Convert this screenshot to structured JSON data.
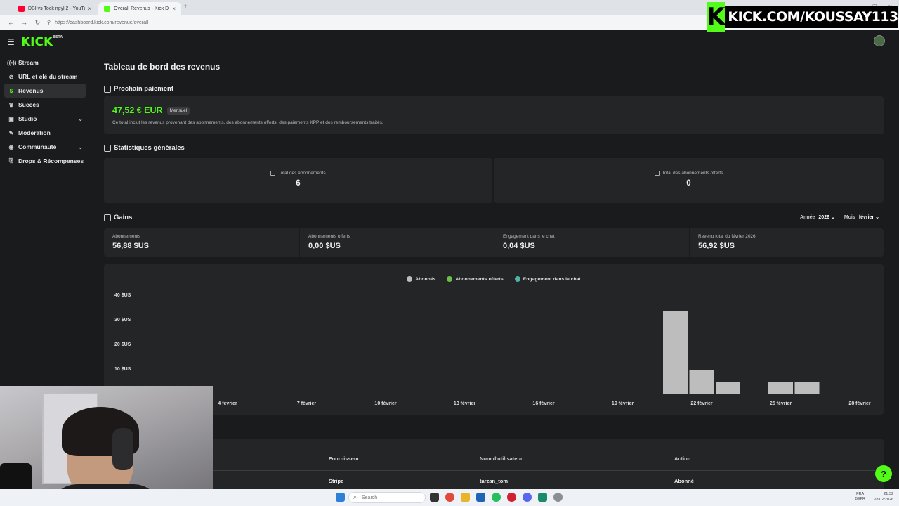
{
  "browser": {
    "tabs": [
      {
        "title": "DBI vs Tock ngyl 2 - YouTube",
        "close": "×",
        "active": false,
        "favicon_color": "#ff0033"
      },
      {
        "title": "Overall Revenus - Kick Dashbo",
        "close": "×",
        "active": true,
        "favicon_color": "#53fc18"
      }
    ],
    "new_tab": "+",
    "url": "https://dashboard.kick.com/revenue/overall",
    "window_controls": [
      "–",
      "□",
      "×"
    ]
  },
  "banner": {
    "k": "K",
    "text": "KICK.COM/KOUSSAY113"
  },
  "app": {
    "logo": "KICK",
    "logo_tag": "BETA",
    "menu_icon": "☰"
  },
  "sidebar": {
    "items": [
      {
        "label": "Stream",
        "icon": "((•))"
      },
      {
        "label": "URL et clé du stream",
        "icon": "⊘"
      },
      {
        "label": "Revenus",
        "icon": "$",
        "active": true
      },
      {
        "label": "Succès",
        "icon": "🏆"
      },
      {
        "label": "Studio",
        "icon": "▣",
        "chevron": "⌄"
      },
      {
        "label": "Modération",
        "icon": "🔧"
      },
      {
        "label": "Communauté",
        "icon": "◉",
        "chevron": "⌄"
      },
      {
        "label": "Drops & Récompenses",
        "icon": "⎘"
      }
    ]
  },
  "main": {
    "title": "Tableau de bord des revenus",
    "next_payment": {
      "section": "Prochain paiement",
      "amount": "47,52 € EUR",
      "badge": "Mensuel",
      "description": "Ce total inclut les revenus provenant des abonnements, des abonnements offerts, des paiements KPP et des remboursements traités."
    },
    "stats": {
      "section": "Statistiques générales",
      "items": [
        {
          "label": "Total des abonnements",
          "value": "6"
        },
        {
          "label": "Total des abonnements offerts",
          "value": "0"
        }
      ]
    },
    "gains": {
      "section": "Gains",
      "year_label": "Année",
      "year_value": "2026",
      "month_label": "Mois",
      "month_value": "février",
      "cells": [
        {
          "label": "Abonnements",
          "value": "56,88 $US"
        },
        {
          "label": "Abonnements offerts",
          "value": "0,00 $US"
        },
        {
          "label": "Engagement dans le chat",
          "value": "0,04 $US"
        },
        {
          "label": "Revenu total du février 2026",
          "value": "56,92 $US"
        }
      ]
    },
    "table": {
      "headers": [
        "Fournisseur",
        "Nom d'utilisateur",
        "Action"
      ],
      "rows": [
        {
          "provider": "Stripe",
          "username": "tarzan_tom",
          "action": "Abonné"
        }
      ]
    }
  },
  "chart_data": {
    "type": "bar",
    "legend": [
      {
        "name": "Abonnés",
        "color": "#bdbdbd"
      },
      {
        "name": "Abonnements offerts",
        "color": "#6cc04a"
      },
      {
        "name": "Engagement dans le chat",
        "color": "#4fb3a6"
      }
    ],
    "y_ticks": [
      "40 $US",
      "30 $US",
      "20 $US",
      "10 $US"
    ],
    "y_tick_values": [
      40,
      30,
      20,
      10
    ],
    "ylim": [
      0,
      40
    ],
    "x_ticks": [
      "4 février",
      "7 février",
      "10 février",
      "13 février",
      "16 février",
      "19 février",
      "22 février",
      "25 février",
      "28 février"
    ],
    "x_tick_days": [
      4,
      7,
      10,
      13,
      16,
      19,
      22,
      25,
      28
    ],
    "day_range": [
      1,
      28
    ],
    "series": [
      {
        "name": "Abonnés",
        "color": "#bdbdbd",
        "points": [
          {
            "day": 21,
            "value": 33.5
          },
          {
            "day": 22,
            "value": 9.6
          },
          {
            "day": 23,
            "value": 4.8
          },
          {
            "day": 25,
            "value": 4.8
          },
          {
            "day": 26,
            "value": 4.8
          }
        ]
      }
    ]
  },
  "taskbar": {
    "search": "Search",
    "lang": "FRA\nBEFR",
    "time": "21:32",
    "date": "28/02/2026"
  },
  "help_icon": "?"
}
